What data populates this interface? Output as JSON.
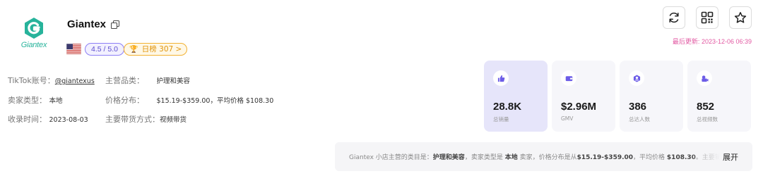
{
  "shop": {
    "logo_text": "Giantex",
    "name": "Giantex",
    "rating": "4.5 / 5.0",
    "rank": {
      "label": "日榜",
      "value": "307",
      "chevron": ">"
    },
    "flag_icon": "us-flag-icon"
  },
  "header": {
    "updated_label": "最后更新:",
    "updated_value": "2023-12-06 06:39",
    "buttons": [
      "refresh-icon",
      "qr-code-icon",
      "star-icon"
    ]
  },
  "info": {
    "tiktok_label": "TikTok账号：",
    "tiktok_value": "@giantexus",
    "main_category_label": "主营品类：",
    "main_category_value": "护理和美容",
    "seller_type_label": "卖家类型：",
    "seller_type_value": "本地",
    "price_dist_label": "价格分布：",
    "price_dist_value": "$15.19-$359.00，平均价格 $108.30",
    "added_label": "收录时间：",
    "added_value": "2023-08-03",
    "sales_mode_label": "主要带货方式：",
    "sales_mode_value": "视频带货"
  },
  "stats": [
    {
      "value": "28.8K",
      "label": "总销量",
      "icon": "thumbs-up-icon",
      "color": "#6c5ce7"
    },
    {
      "value": "$2.96M",
      "label": "GMV",
      "icon": "wallet-icon",
      "color": "#6c5ce7"
    },
    {
      "value": "386",
      "label": "总达人数",
      "icon": "creator-icon",
      "color": "#6c5ce7"
    },
    {
      "value": "852",
      "label": "总视频数",
      "icon": "video-icon",
      "color": "#6c5ce7"
    }
  ],
  "summary": {
    "p1": "Giantex 小店主营的类目是：",
    "b1": "护理和美容",
    "p2": "，卖家类型是 ",
    "b2": "本地",
    "p3": " 卖家，价格分布是从",
    "b3": "$15.19-$359.00",
    "p4": "，平均价格 ",
    "b4": "$108.30",
    "p5": "。主要销",
    "expand_label": "展开"
  },
  "colors": {
    "brand_teal": "#27b39b",
    "accent_purple": "#6c5ce7",
    "updated_pink": "#e25aa3",
    "rank_orange": "#e0940c"
  }
}
